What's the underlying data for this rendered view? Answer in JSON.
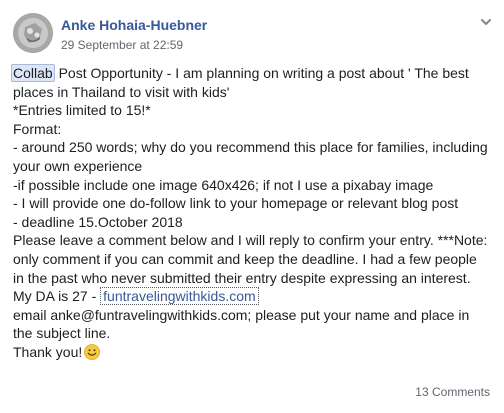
{
  "post": {
    "author": "Anke Hohaia-Huebner",
    "timestamp": "29 September at 22:59",
    "icons": {
      "avatar": "profile-avatar",
      "menu": "chevron-down-icon",
      "emoji": "smiley-face-icon"
    },
    "lines": {
      "l1_highlight": "Collab",
      "l1_rest": " Post Opportunity - I am planning on writing a post about ' The best",
      "l2": "places in Thailand to visit with kids'",
      "l3": "*Entries limited to 15!*",
      "l4": "Format:",
      "l5": "- around 250 words; why do you recommend this place for families, including",
      "l6": "your own experience",
      "l7": "-if possible include one image 640x426; if not I use a pixabay image",
      "l8": "- I will provide one do-follow link to your homepage or relevant blog post",
      "l9": "- deadline 15.October 2018",
      "l10": "Please leave a comment below and I will reply to confirm your entry. ***Note:",
      "l11": "only comment if you can commit and keep the deadline. I had a few people",
      "l12": "in the past who never submitted their entry despite expressing an interest.",
      "l13_prefix": "My DA is 27 - ",
      "l13_link": "funtravelingwithkids.com",
      "l14": "email anke@funtravelingwithkids.com; please put your name and place in",
      "l15": "the subject line.",
      "l16": "Thank you!"
    },
    "comments_count": "13 Comments"
  }
}
